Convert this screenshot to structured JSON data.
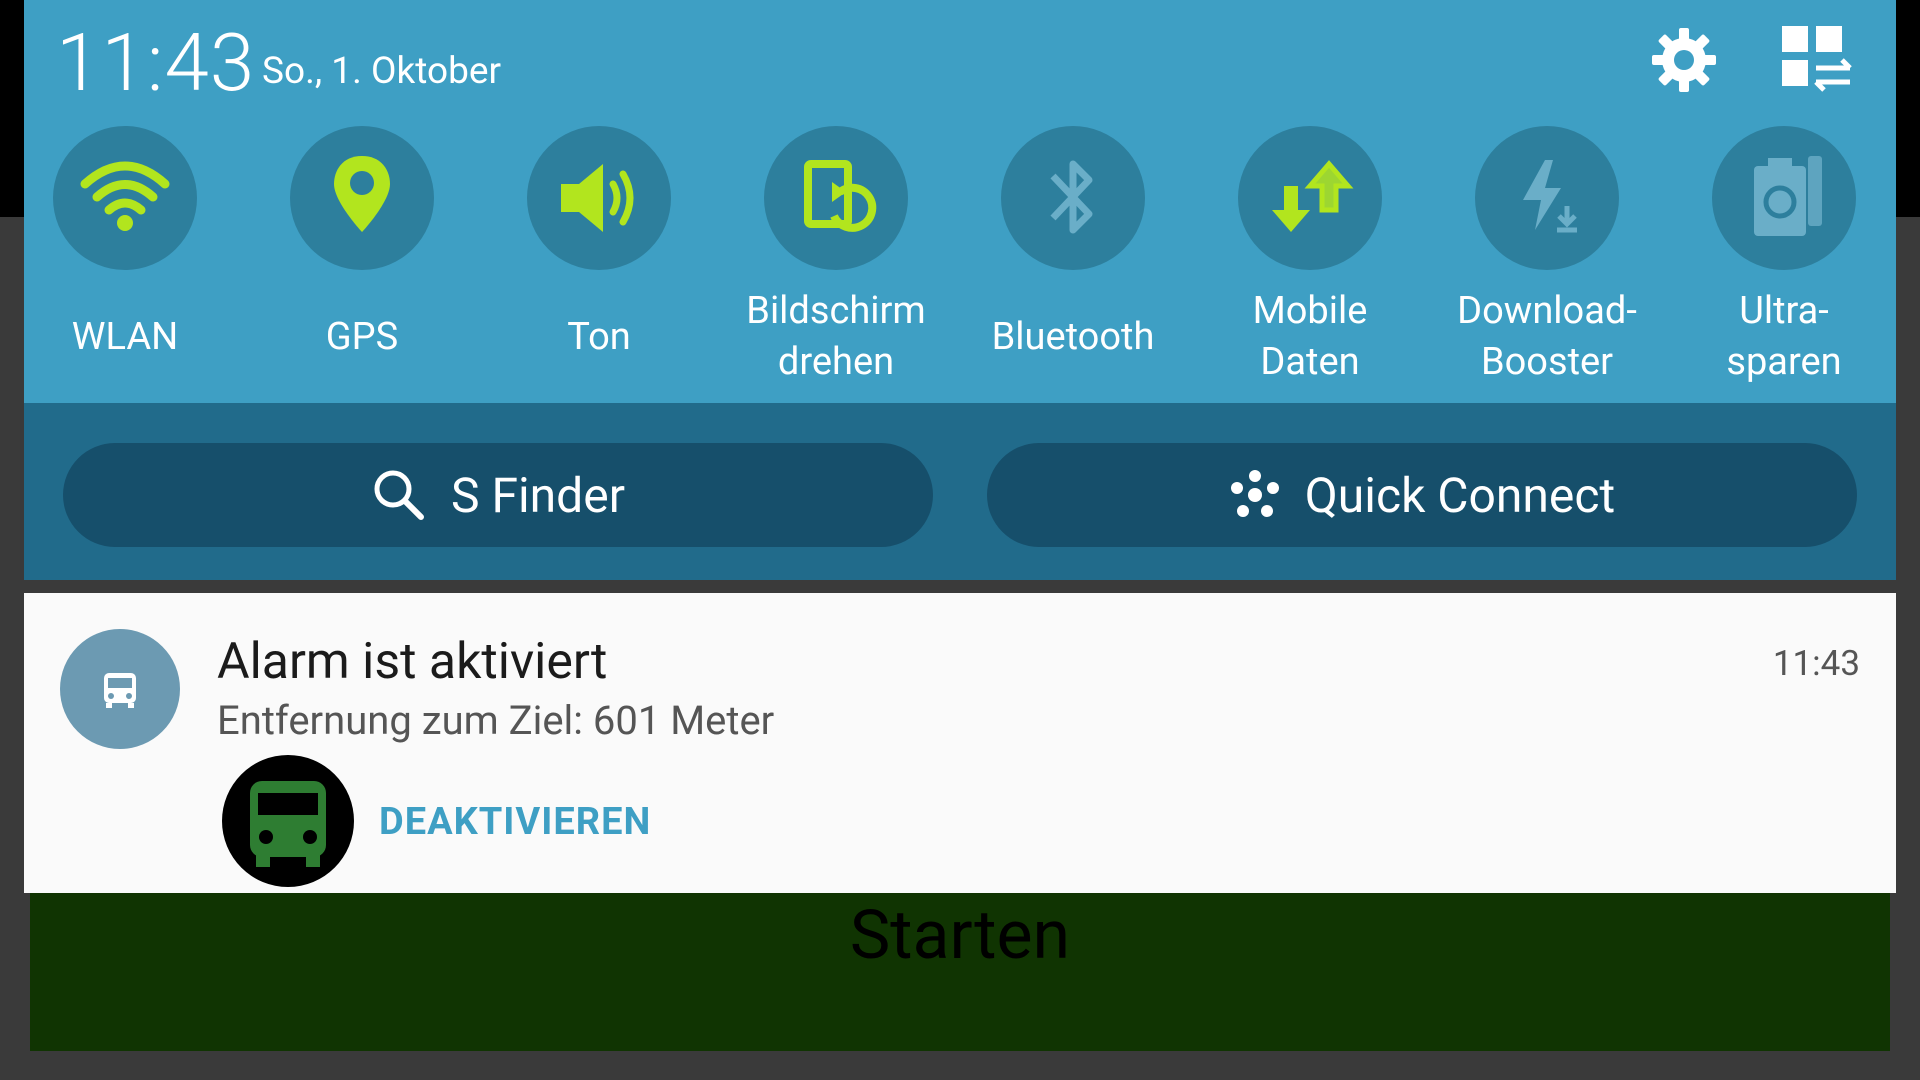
{
  "status": {
    "time": "11:43",
    "date": "So., 1. Oktober"
  },
  "quick_settings": [
    {
      "label": "WLAN",
      "icon": "wifi-icon",
      "active": true
    },
    {
      "label": "GPS",
      "icon": "location-pin-icon",
      "active": true
    },
    {
      "label": "Ton",
      "icon": "speaker-icon",
      "active": true
    },
    {
      "label": "Bildschirm drehen",
      "icon": "rotate-screen-icon",
      "active": true
    },
    {
      "label": "Bluetooth",
      "icon": "bluetooth-icon",
      "active": false
    },
    {
      "label": "Mobile Daten",
      "icon": "mobile-data-icon",
      "active": true
    },
    {
      "label": "Download-Booster",
      "icon": "download-booster-icon",
      "active": false
    },
    {
      "label": "Ultra-sparen",
      "icon": "ultra-power-saving-icon",
      "active": false
    }
  ],
  "buttons": {
    "s_finder": "S Finder",
    "quick_connect": "Quick Connect"
  },
  "notification": {
    "title": "Alarm ist aktiviert",
    "time": "11:43",
    "text": "Entfernung zum Ziel: 601 Meter",
    "action": "DEAKTIVIEREN"
  },
  "background_app": {
    "button_label": "Starten"
  },
  "colors": {
    "panel": "#3e9fc4",
    "active_icon": "#b2e51e",
    "inactive_icon": "#6aaec8",
    "accent": "#3e9fc4"
  }
}
